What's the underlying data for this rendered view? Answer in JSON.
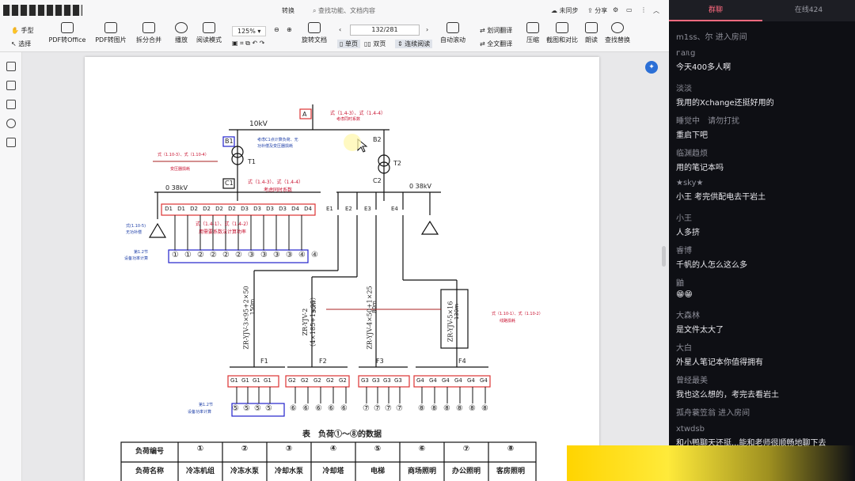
{
  "app": {
    "title_tab": "转换",
    "search_placeholder": "查找功能、文档内容",
    "sync": "未同步",
    "share": "分享",
    "page_indicator": "132/281",
    "zoom": "125%"
  },
  "toolbar": {
    "hand": "手型",
    "select": "选择",
    "pdf_to_office": "PDF转Office",
    "pdf_to_image": "PDF转图片",
    "split_merge": "拆分合并",
    "play": "播放",
    "read_mode": "阅读模式",
    "rotate": "旋转文档",
    "single": "单页",
    "double": "双页",
    "continuous": "连续阅读",
    "auto_scroll": "自动滚动",
    "word_translate": "划词翻译",
    "full_translate": "全文翻译",
    "compress": "压缩",
    "screenshot_compare": "截图和对比",
    "read_aloud": "朗读",
    "find_replace": "查找替换"
  },
  "diagram": {
    "label_A": "A",
    "label_B1": "B1",
    "label_B2": "B2",
    "label_T1": "T1",
    "label_T2": "T2",
    "label_C1": "C1",
    "label_C2": "C2",
    "v10": "10kV",
    "v038_left": "0 38kV",
    "v038_right": "0 38kV",
    "note_top": "式（1.4-3）、式（1.4-4）",
    "note_top2": "考虑同时系数",
    "note_b1": "考虑C1点计算负荷、无",
    "note_b1b": "功补偿及变压器损耗",
    "note_t1": "式（1.10-3）、式（1.10-4）",
    "note_t1b": "变压器损耗",
    "note_c1": "式（1.4-3）、式（1.4-4）",
    "note_c1b": "考虑同时系数",
    "note_d": "式（1.4-1）、式（1.4-2）",
    "note_d2": "用需要系数法计算功率",
    "note_cap": "式(1.10-5)",
    "note_cap2": "无功补偿",
    "note_dev": "第1.2节",
    "note_dev2": "设备功率计算",
    "note_f4": "式（1.10-1）、式（1.10-2）",
    "note_f4b": "线路损耗",
    "note_dev_b": "第1.2节",
    "note_dev_b2": "设备功率计算",
    "d_labels": [
      "D1",
      "D1",
      "D2",
      "D2",
      "D2",
      "D2",
      "D3",
      "D3",
      "D3",
      "D3",
      "D4",
      "D4"
    ],
    "e_labels": [
      "E1",
      "E2",
      "E3",
      "E4"
    ],
    "d_circles": [
      "①",
      "①",
      "②",
      "②",
      "②",
      "②",
      "③",
      "③",
      "③",
      "③",
      "④",
      "④"
    ],
    "cables": [
      "ZR-YJV-3×95+2×50",
      "ZR-YJV-2（4×185+1×95）",
      "ZR-YJV-4×50+1×25",
      "ZR-YJV-5×16"
    ],
    "lengths": [
      "150m",
      "50m",
      "80m",
      "130m"
    ],
    "f_labels": [
      "F1",
      "F2",
      "F3",
      "F4"
    ],
    "g1": [
      "G1",
      "G1",
      "G1",
      "G1"
    ],
    "g2": [
      "G2",
      "G2",
      "G2",
      "G2",
      "G2"
    ],
    "g3": [
      "G3",
      "G3",
      "G3",
      "G3"
    ],
    "g4": [
      "G4",
      "G4",
      "G4",
      "G4",
      "G4",
      "G4"
    ],
    "c5": [
      "⑤",
      "⑤",
      "⑤",
      "⑤"
    ],
    "c6": [
      "⑥",
      "⑥",
      "⑥",
      "⑥",
      "⑥"
    ],
    "c7": [
      "⑦",
      "⑦",
      "⑦",
      "⑦"
    ],
    "c8": [
      "⑧",
      "⑧",
      "⑧",
      "⑧",
      "⑧",
      "⑧"
    ]
  },
  "table": {
    "caption": "表　负荷①～⑧的数据",
    "row1_head": "负荷编号",
    "row1": [
      "①",
      "②",
      "③",
      "④",
      "⑤",
      "⑥",
      "⑦",
      "⑧"
    ],
    "row2_head": "负荷名称",
    "row2": [
      "冷冻机组",
      "冷冻水泵",
      "冷却水泵",
      "冷却塔",
      "电梯",
      "商场照明",
      "办公照明",
      "客房照明"
    ]
  },
  "chat": {
    "tab_chat": "群聊",
    "tab_online": "在线424",
    "messages": [
      {
        "name": "m1ss、尔 进入房间",
        "text": ""
      },
      {
        "name": "ᴦaᥰg",
        "text": "今天400多人啊"
      },
      {
        "name": "淡淡",
        "text": "我用的Xchange还挺好用的"
      },
      {
        "name": "睡觉中　请勿打扰",
        "text": "重启下吧"
      },
      {
        "name": "临渊趋烦",
        "text": "用的笔记本吗"
      },
      {
        "name": "★sky★",
        "text": "小王 考完供配电去干岩土"
      },
      {
        "name": "小王",
        "text": "人多挤"
      },
      {
        "name": "睿博",
        "text": "千帆的人怎么这么多"
      },
      {
        "name": "鼬",
        "text": "😁😁"
      },
      {
        "name": "大森林",
        "text": "是文件太大了"
      },
      {
        "name": "大白",
        "text": "外星人笔记本你值得拥有"
      },
      {
        "name": "曾经最美",
        "text": "我也这么想的，考完去看岩土"
      },
      {
        "name": "孤舟蓑笠翁 进入房间",
        "text": ""
      },
      {
        "name": "xtwdsb",
        "text": "和小鸭聊天还挺...能和老师很顺畅地聊下去"
      }
    ]
  },
  "colors": {
    "accent": "#2b6fd6",
    "red_note": "#c8102e",
    "blue_note": "#1e3fa8",
    "chat_bg": "#0e0f14",
    "banner": "#ffd400"
  }
}
